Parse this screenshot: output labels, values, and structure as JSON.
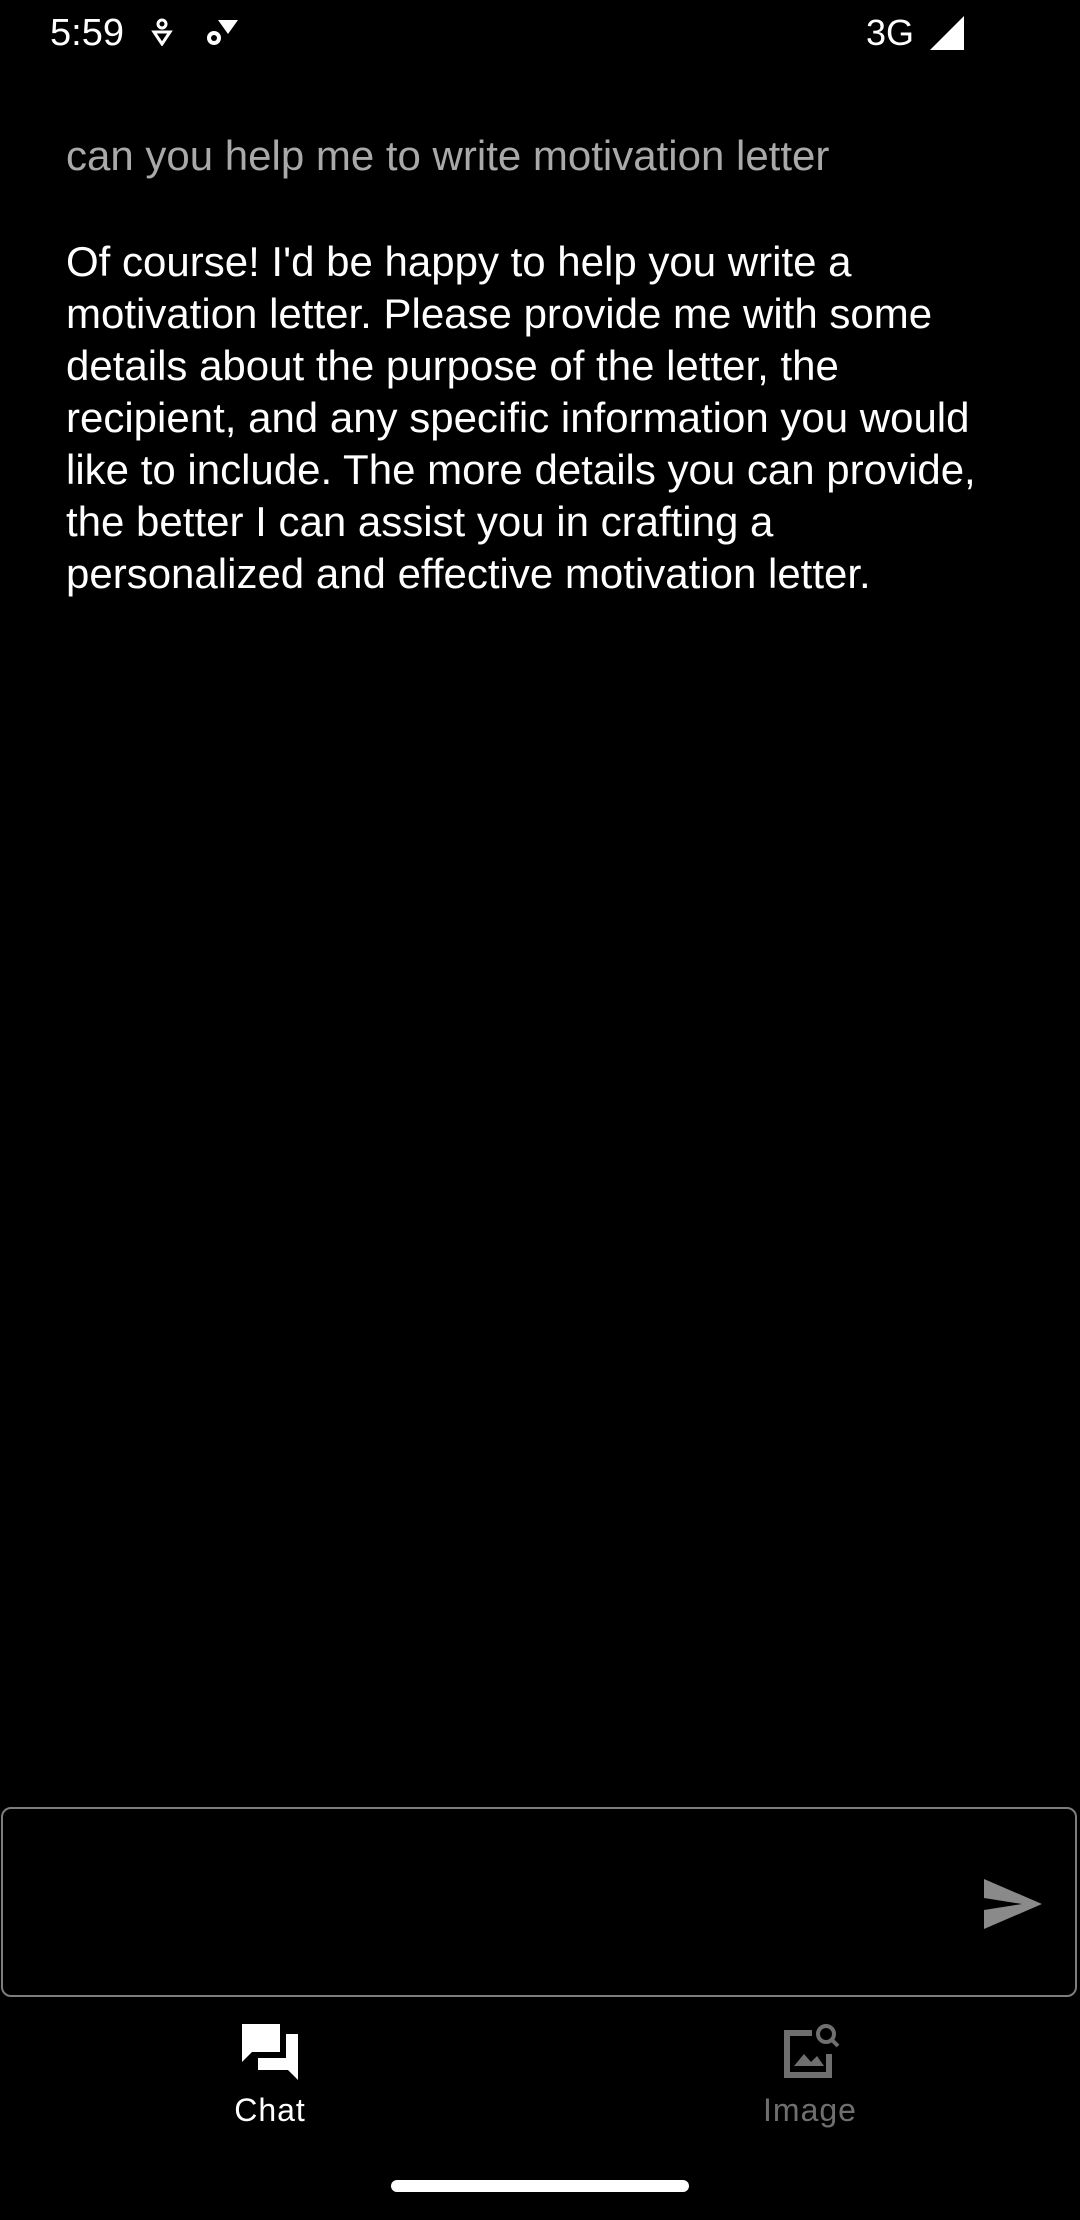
{
  "status_bar": {
    "time": "5:59",
    "network": "3G",
    "icons": [
      "security-icon",
      "settings-wifi-icon",
      "signal-icon"
    ]
  },
  "chat": {
    "user_message": "can you help me to write motivation letter",
    "bot_message": "Of course! I'd be happy to help you write a motivation letter. Please provide me with some details about the purpose of the letter, the recipient, and any specific information you would like to include. The more details you can provide, the better I can assist you in crafting a personalized and effective motivation letter."
  },
  "input": {
    "value": "",
    "placeholder": "",
    "send_icon": "send-icon"
  },
  "bottom_nav": {
    "items": [
      {
        "label": "Chat",
        "icon": "chat-icon",
        "active": true
      },
      {
        "label": "Image",
        "icon": "image-search-icon",
        "active": false
      }
    ]
  },
  "colors": {
    "background": "#000000",
    "text_primary": "#ffffff",
    "text_user": "#a9a9a9",
    "inactive": "#6f6f6f",
    "border": "#7d7d7d"
  }
}
